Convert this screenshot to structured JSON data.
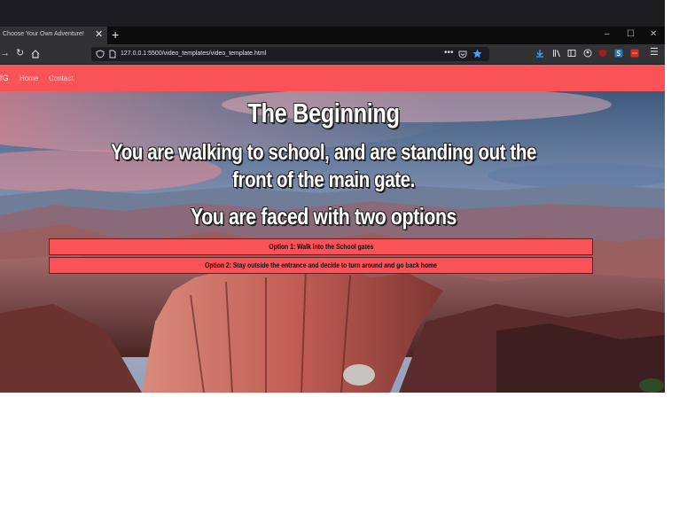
{
  "browser": {
    "tab_title": "Choose Your Own Adventure!",
    "url": "127.0.0.1:5500/video_templates/video_template.html",
    "colors": {
      "tabbar": "#0c0c0d",
      "toolbar": "#323234",
      "urlbar": "#1c1b22",
      "star": "#44a3ff"
    }
  },
  "site": {
    "brand": "IG",
    "nav": [
      "Home",
      "Contact"
    ],
    "accent_color": "#f95257"
  },
  "story": {
    "title": "The Beginning",
    "scenario": "You are walking to school, and are standing out the front of the main gate.",
    "prompt": "You are faced with two options",
    "options": [
      "Option 1: Walk into the School gates",
      "Option 2: Stay outside the entrance and decide to turn around and go back home"
    ]
  }
}
